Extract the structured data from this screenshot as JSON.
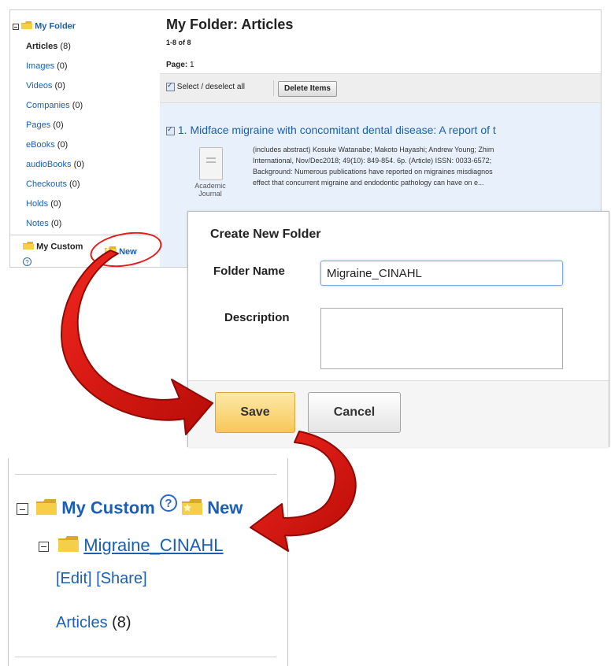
{
  "colors": {
    "link": "#1a5fb4",
    "arrow": "#d9130d",
    "save_button": "#f7c75a",
    "folder": "#f2c738"
  },
  "sidebar": {
    "root_label": "My Folder",
    "items": [
      {
        "label": "Articles",
        "count": "(8)",
        "active": true
      },
      {
        "label": "Images",
        "count": "(0)"
      },
      {
        "label": "Videos",
        "count": "(0)"
      },
      {
        "label": "Companies",
        "count": "(0)"
      },
      {
        "label": "Pages",
        "count": "(0)"
      },
      {
        "label": "eBooks",
        "count": "(0)"
      },
      {
        "label": "audioBooks",
        "count": "(0)"
      },
      {
        "label": "Checkouts",
        "count": "(0)"
      },
      {
        "label": "Holds",
        "count": "(0)"
      },
      {
        "label": "Notes",
        "count": "(0)"
      }
    ],
    "custom_label": "My Custom",
    "new_label": "New",
    "help": "?"
  },
  "main": {
    "title": "My Folder: Articles",
    "count_text": "1-8 of 8",
    "page_label": "Page:",
    "page_number": "1",
    "select_all_label": "Select / deselect all",
    "delete_label": "Delete Items",
    "result": {
      "title": "1. Midface migraine with concomitant dental disease: A report of t",
      "abstract_lines": [
        "(includes abstract) Kosuke Watanabe; Makoto Hayashi; Andrew Young; Zhim",
        "International, Nov/Dec2018; 49(10): 849-854. 6p. (Article) ISSN: 0033-6572;",
        "Background: Numerous publications have reported on migraines misdiagnos",
        "effect that concurrent migraine and endodontic pathology can have on e..."
      ],
      "doc_type_line1": "Academic",
      "doc_type_line2": "Journal"
    }
  },
  "dialog": {
    "title": "Create New Folder",
    "folder_name_label": "Folder Name",
    "folder_name_value": "Migraine_CINAHL",
    "description_label": "Description",
    "description_value": "",
    "save_label": "Save",
    "cancel_label": "Cancel"
  },
  "result_panel": {
    "custom_label": "My Custom",
    "help": "?",
    "new_label": "New",
    "folder_label": "Migraine_CINAHL",
    "edit_label": "[Edit]",
    "share_label": "[Share]",
    "articles_label": "Articles",
    "articles_count": "(8)"
  }
}
